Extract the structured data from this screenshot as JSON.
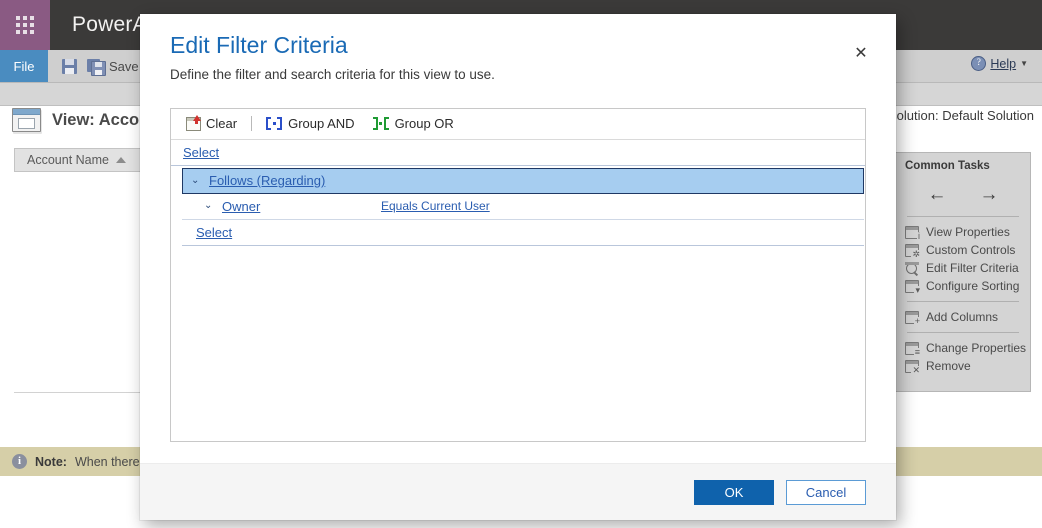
{
  "background": {
    "app_title": "PowerApps",
    "waffle_icon": "waffle-grid-icon",
    "file_tab": "File",
    "save_label": "Save",
    "save_as_label": "Save As",
    "help_label": "Help",
    "help_icon": "help-globe-icon",
    "solution_text": "n solution: Default Solution",
    "view_title": "View: Accou",
    "view_icon": "view-window-icon",
    "grid_column_header": "Account Name",
    "sort_icon": "sort-ascending-icon",
    "note_prefix": "Note:",
    "note_text": "When there are",
    "note_icon": "info-icon",
    "tasks": {
      "title": "Common Tasks",
      "back_icon": "arrow-left-icon",
      "forward_icon": "arrow-right-icon",
      "items": [
        {
          "label": "View Properties",
          "icon": "view-properties-icon"
        },
        {
          "label": "Custom Controls",
          "icon": "custom-controls-icon"
        },
        {
          "label": "Edit Filter Criteria",
          "icon": "magnifier-icon"
        },
        {
          "label": "Configure Sorting",
          "icon": "configure-sorting-icon"
        },
        {
          "label": "Add Columns",
          "icon": "add-columns-icon"
        },
        {
          "label": "Change Properties",
          "icon": "change-properties-icon"
        },
        {
          "label": "Remove",
          "icon": "remove-icon"
        }
      ]
    }
  },
  "dialog": {
    "title": "Edit Filter Criteria",
    "subtitle": "Define the filter and search criteria for this view to use.",
    "close_icon": "close-icon",
    "toolbar": {
      "clear_label": "Clear",
      "clear_icon": "clear-icon",
      "group_and_label": "Group AND",
      "group_and_icon": "group-and-icon",
      "group_or_label": "Group OR",
      "group_or_icon": "group-or-icon"
    },
    "criteria": {
      "select_top_label": "Select",
      "select_bottom_label": "Select",
      "group": {
        "label": "Follows (Regarding)",
        "expander_icon": "chevron-down-icon",
        "selected": true
      },
      "condition": {
        "field": "Owner",
        "operator_value": "Equals Current User",
        "expander_icon": "chevron-down-icon"
      }
    },
    "footer": {
      "ok_label": "OK",
      "cancel_label": "Cancel"
    },
    "colors": {
      "title_blue": "#1a6ab5",
      "link_blue": "#2a5db0",
      "selection_fill": "#a6cdf0",
      "selection_border": "#1f3864",
      "primary_button": "#0f62ac",
      "group_and_icon": "#2b4fc9",
      "group_or_icon": "#1f9b34",
      "clear_arrow": "#d1332e"
    }
  }
}
